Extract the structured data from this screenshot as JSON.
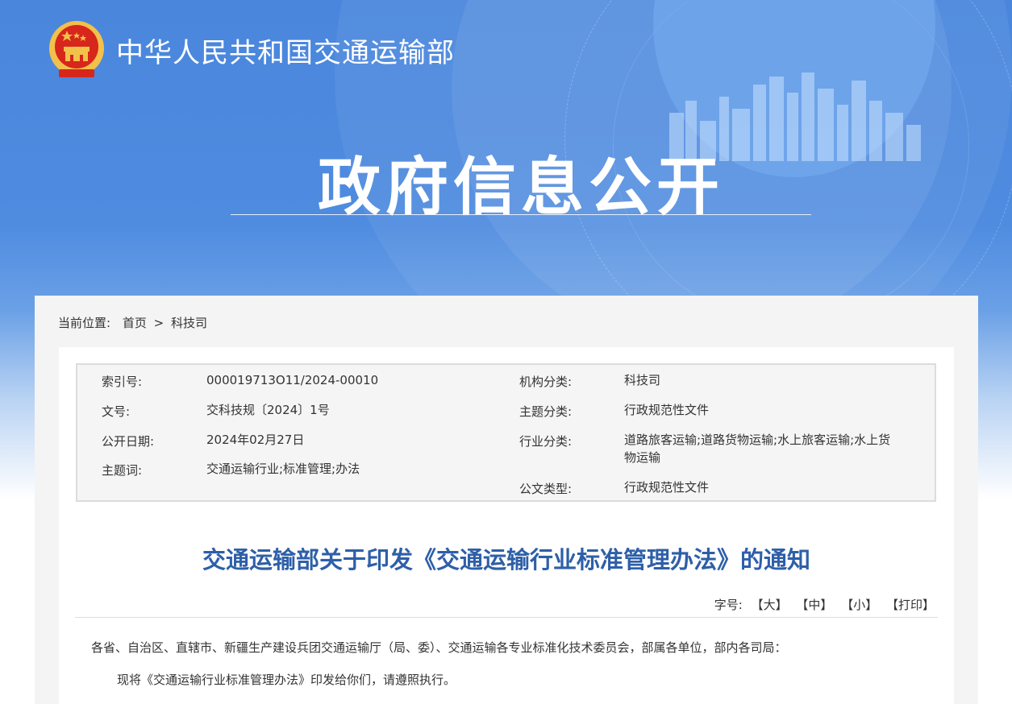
{
  "header": {
    "site_name": "中华人民共和国交通运输部",
    "section_title": "政府信息公开"
  },
  "breadcrumb": {
    "prefix": "当前位置:",
    "home": "首页",
    "separator": ">",
    "current": "科技司"
  },
  "meta": {
    "index_label": "索引号:",
    "index_value": "000019713O11/2024-00010",
    "doc_no_label": "文号:",
    "doc_no_value": "交科技规〔2024〕1号",
    "date_label": "公开日期:",
    "date_value": "2024年02月27日",
    "keywords_label": "主题词:",
    "keywords_value": "交通运输行业;标准管理;办法",
    "org_label": "机构分类:",
    "org_value": "科技司",
    "topic_label": "主题分类:",
    "topic_value": "行政规范性文件",
    "industry_label": "行业分类:",
    "industry_value_1": "道路旅客运输;道路货物运输;水上旅客运输;水上货",
    "industry_value_2": "物运输",
    "doc_type_label": "公文类型:",
    "doc_type_value": "行政规范性文件"
  },
  "document": {
    "title": "交通运输部关于印发《交通运输行业标准管理办法》的通知",
    "font_size_label": "字号:",
    "font_large": "【大】",
    "font_medium": "【中】",
    "font_small": "【小】",
    "print": "【打印】",
    "paragraph_1": "各省、自治区、直辖市、新疆生产建设兵团交通运输厅（局、委）、交通运输各专业标准化技术委员会，部属各单位，部内各司局：",
    "paragraph_2": "现将《交通运输行业标准管理办法》印发给你们，请遵照执行。"
  },
  "colors": {
    "banner_blue": "#4f8ce0",
    "title_blue": "#2e5fa8",
    "emblem_red": "#d7261c",
    "emblem_gold": "#f2c14a"
  }
}
